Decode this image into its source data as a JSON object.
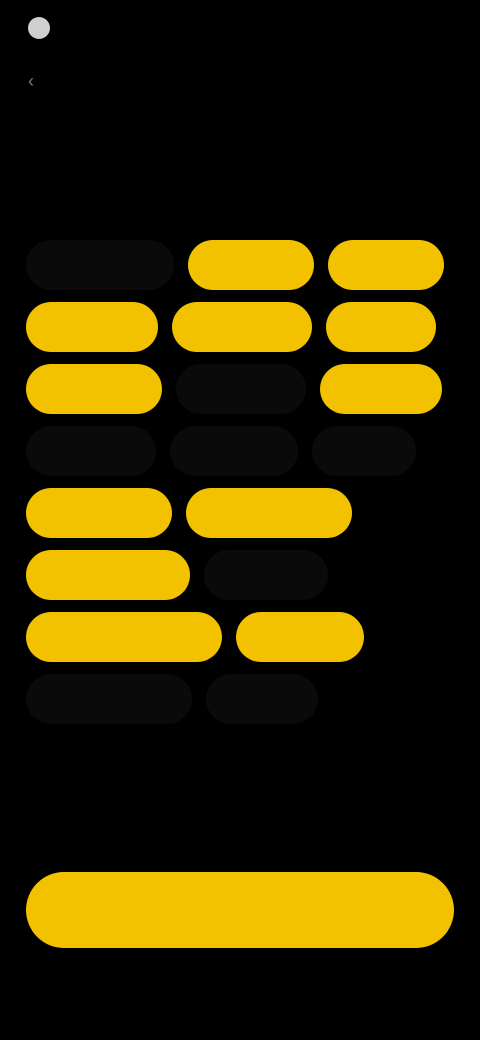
{
  "app": {
    "brand": "",
    "heading": ""
  },
  "colors": {
    "accent": "#f2c200",
    "background": "#000000"
  },
  "rows": [
    [
      {
        "label": "",
        "emoji": "",
        "selected": false,
        "w": 148
      },
      {
        "label": "",
        "emoji": "",
        "selected": true,
        "w": 126
      },
      {
        "label": "",
        "emoji": "",
        "selected": true,
        "w": 116
      }
    ],
    [
      {
        "label": "",
        "emoji": "",
        "selected": true,
        "w": 132
      },
      {
        "label": "",
        "emoji": "",
        "selected": true,
        "w": 140
      },
      {
        "label": "",
        "emoji": "",
        "selected": true,
        "w": 110
      }
    ],
    [
      {
        "label": "",
        "emoji": "",
        "selected": true,
        "w": 136
      },
      {
        "label": "",
        "emoji": "",
        "selected": false,
        "w": 130
      },
      {
        "label": "",
        "emoji": "",
        "selected": true,
        "w": 122
      }
    ],
    [
      {
        "label": "",
        "emoji": "",
        "selected": false,
        "w": 130
      },
      {
        "label": "",
        "emoji": "",
        "selected": false,
        "w": 128
      },
      {
        "label": "",
        "emoji": "",
        "selected": false,
        "w": 104
      }
    ],
    [
      {
        "label": "",
        "emoji": "",
        "selected": true,
        "w": 146
      },
      {
        "label": "",
        "emoji": "",
        "selected": true,
        "w": 166
      }
    ],
    [
      {
        "label": "",
        "emoji": "",
        "selected": true,
        "w": 164
      },
      {
        "label": "",
        "emoji": "",
        "selected": false,
        "w": 124
      }
    ],
    [
      {
        "label": "",
        "emoji": "",
        "selected": true,
        "w": 196
      },
      {
        "label": "",
        "emoji": "",
        "selected": true,
        "w": 128
      }
    ],
    [
      {
        "label": "",
        "emoji": "",
        "selected": false,
        "w": 166
      },
      {
        "label": "",
        "emoji": "",
        "selected": false,
        "w": 112
      }
    ]
  ],
  "footer_options": [
    "",
    "",
    ""
  ],
  "continue_label": ""
}
